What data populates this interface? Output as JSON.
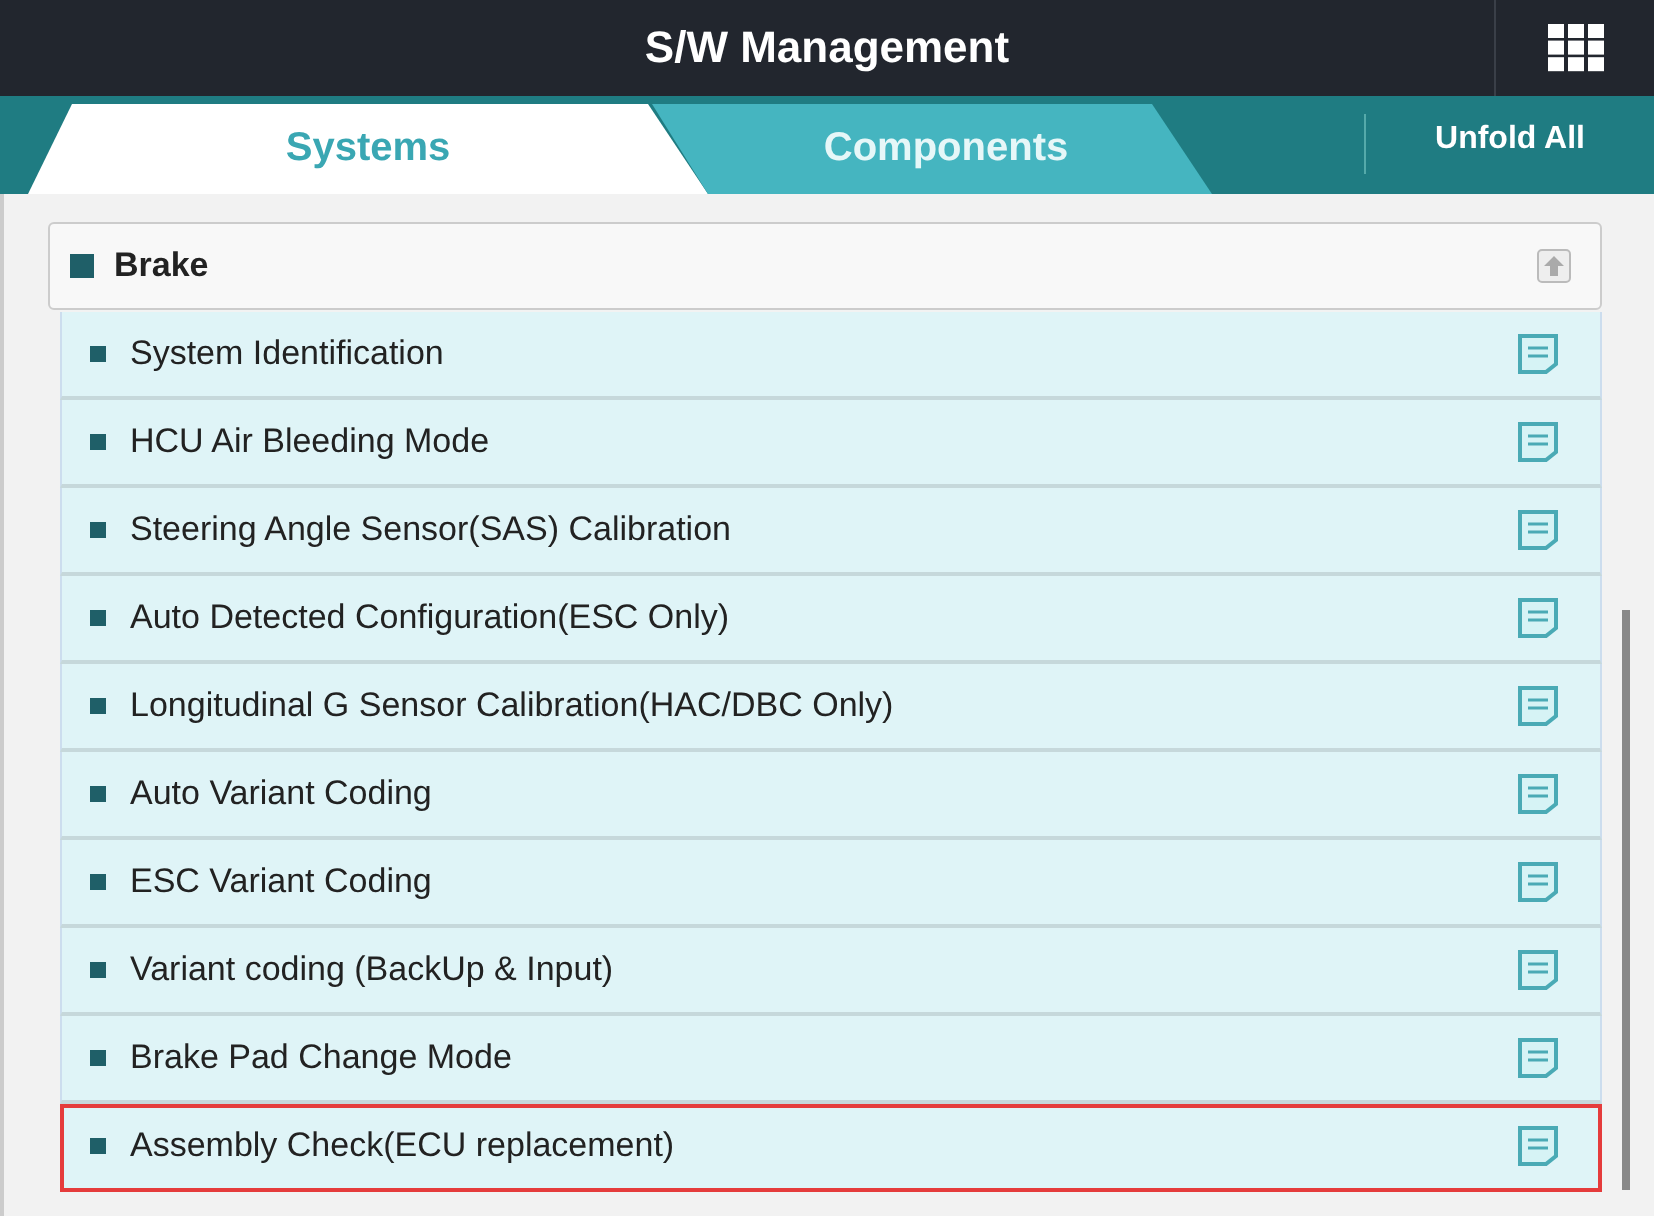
{
  "header": {
    "title": "S/W Management"
  },
  "tabs": [
    {
      "label": "Systems",
      "selected": true
    },
    {
      "label": "Components",
      "selected": false
    }
  ],
  "unfold_button": "Unfold All",
  "group": {
    "title": "Brake",
    "expanded": true,
    "items": [
      {
        "label": "System Identification",
        "highlighted": false
      },
      {
        "label": "HCU Air Bleeding Mode",
        "highlighted": false
      },
      {
        "label": "Steering Angle Sensor(SAS) Calibration",
        "highlighted": false
      },
      {
        "label": "Auto Detected Configuration(ESC Only)",
        "highlighted": false
      },
      {
        "label": "Longitudinal G Sensor Calibration(HAC/DBC Only)",
        "highlighted": false
      },
      {
        "label": "Auto Variant Coding",
        "highlighted": false
      },
      {
        "label": "ESC Variant Coding",
        "highlighted": false
      },
      {
        "label": "Variant coding (BackUp & Input)",
        "highlighted": false
      },
      {
        "label": "Brake Pad Change Mode",
        "highlighted": false
      },
      {
        "label": "Assembly Check(ECU replacement)",
        "highlighted": true
      }
    ]
  }
}
